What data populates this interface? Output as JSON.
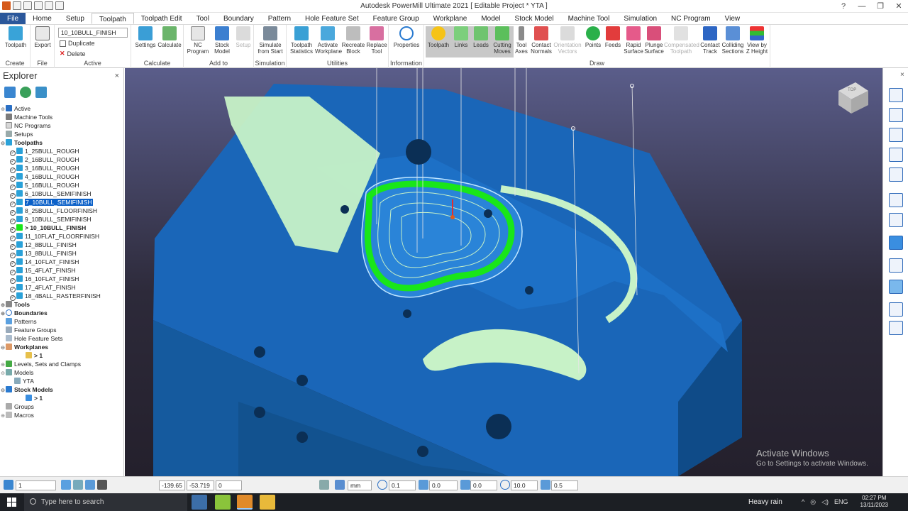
{
  "window": {
    "title": "Autodesk PowerMill Ultimate 2021   [ Editable Project * YTA ]",
    "help": "?",
    "minimize": "—",
    "restore": "❐",
    "close": "✕"
  },
  "tabs": [
    "File",
    "Home",
    "Setup",
    "Toolpath",
    "Toolpath Edit",
    "Tool",
    "Boundary",
    "Pattern",
    "Hole Feature Set",
    "Feature Group",
    "Workplane",
    "Model",
    "Stock Model",
    "Machine Tool",
    "Simulation",
    "NC Program",
    "View"
  ],
  "ribbon": {
    "create": {
      "label": "Create",
      "toolpath": "Toolpath"
    },
    "file": {
      "label": "File",
      "export": "Export"
    },
    "active": {
      "label": "Active",
      "selected": "10_10BULL_FINISH",
      "duplicate": "Duplicate",
      "delete": "Delete"
    },
    "calculate": {
      "label": "Calculate",
      "settings": "Settings",
      "calculate": "Calculate"
    },
    "addto": {
      "label": "Add to",
      "nc_program": "NC Program",
      "stock_model": "Stock Model",
      "setup": "Setup"
    },
    "simulation": {
      "label": "Simulation",
      "simulate": "Simulate from Start"
    },
    "utilities": {
      "label": "Utilities",
      "toolpath_statistics": "Toolpath Statistics",
      "activate_workplane": "Activate Workplane",
      "recreate_block": "Recreate Block",
      "replace_tool": "Replace Tool"
    },
    "information": {
      "label": "Information",
      "properties": "Properties"
    },
    "draw": {
      "label": "Draw",
      "items": [
        "Toolpath",
        "Links",
        "Leads",
        "Cutting Moves",
        "Tool Axes",
        "Contact Normals",
        "Orientation Vectors",
        "Points",
        "Feeds",
        "Rapid Surface",
        "Plunge Surface",
        "Compensated Toolpath",
        "Contact Track",
        "Colliding Sections",
        "View by Z Height"
      ]
    }
  },
  "explorer": {
    "title": "Explorer",
    "close": "×",
    "top": [
      "Active",
      "Machine Tools",
      "NC Programs",
      "Setups"
    ],
    "toolpaths_label": "Toolpaths",
    "toolpaths": [
      "1_25BULL_ROUGH",
      "2_16BULL_ROUGH",
      "3_16BULL_ROUGH",
      "4_16BULL_ROUGH",
      "5_16BULL_ROUGH",
      "6_10BULL_SEMIFINISH",
      "7_10BULL_SEMIFINISH",
      "8_25BULL_FLOORFINISH",
      "9_10BULL_SEMIFINISH",
      "> 10_10BULL_FINISH",
      "11_10FLAT_FLOORFINISH",
      "12_8BULL_FINISH",
      "13_8BULL_FINISH",
      "14_10FLAT_FINISH",
      "15_4FLAT_FINISH",
      "16_10FLAT_FINISH",
      "17_4FLAT_FINISH",
      "18_4BALL_RASTERFINISH"
    ],
    "tools": "Tools",
    "boundaries": "Boundaries",
    "patterns": "Patterns",
    "feature_groups": "Feature Groups",
    "hole_feature_sets": "Hole Feature Sets",
    "workplanes": "Workplanes",
    "workplane_child": "> 1",
    "levels": "Levels, Sets and Clamps",
    "models": "Models",
    "model_child": "YTA",
    "stock_models": "Stock Models",
    "stock_child": "> 1",
    "groups": "Groups",
    "macros": "Macros"
  },
  "viewport": {
    "cube_label": "TOP",
    "watermark_title": "Activate Windows",
    "watermark_sub": "Go to Settings to activate Windows.",
    "close": "×"
  },
  "status": {
    "workplane": "1",
    "x": "-139.65",
    "y": "-53.719",
    "z": "0",
    "units": "mm",
    "tol": "0.1",
    "thickness": "0.0",
    "axial": "0.0",
    "step": "10.0",
    "ratio": "0.5"
  },
  "taskbar": {
    "search": "Type here to search",
    "weather": "Heavy rain",
    "lang": "ENG",
    "time": "02:27 PM",
    "date": "13/11/2023"
  },
  "colors": {
    "accent": "#2b579a",
    "model": "#1b6ec2",
    "toolpath": "#c7f2c7",
    "selected_path": "#19e619"
  }
}
